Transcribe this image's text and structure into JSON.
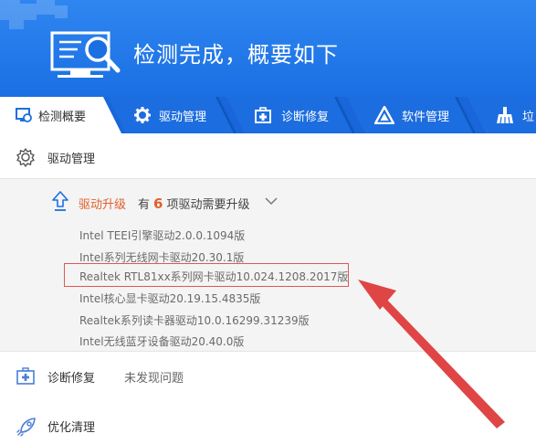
{
  "header": {
    "title": "检测完成，概要如下"
  },
  "tabs": [
    {
      "label": "检测概要",
      "active": true
    },
    {
      "label": "驱动管理",
      "active": false
    },
    {
      "label": "诊断修复",
      "active": false
    },
    {
      "label": "软件管理",
      "active": false
    },
    {
      "label": "垃",
      "active": false
    }
  ],
  "sections": {
    "driver": {
      "label": "驱动管理"
    },
    "diagnosis": {
      "label": "诊断修复",
      "status": "未发现问题"
    },
    "cleanup": {
      "label": "优化清理"
    }
  },
  "upgrade": {
    "title": "驱动升级",
    "prefix": "有",
    "count": "6",
    "suffix": "项驱动需要升级"
  },
  "drivers": [
    "Intel TEEI引擎驱动2.0.0.1094版",
    "Intel系列无线网卡驱动20.30.1版",
    "Realtek RTL81xx系列网卡驱动10.024.1208.2017版",
    "Intel核心显卡驱动20.19.15.4835版",
    "Realtek系列读卡器驱动10.0.16299.31239版",
    "Intel无线蓝牙设备驱动20.40.0版"
  ],
  "colors": {
    "header_blue": "#1a6fe3",
    "tab_bar": "#1866d9",
    "accent_orange": "#e0602a",
    "highlight_red": "#e15757"
  }
}
